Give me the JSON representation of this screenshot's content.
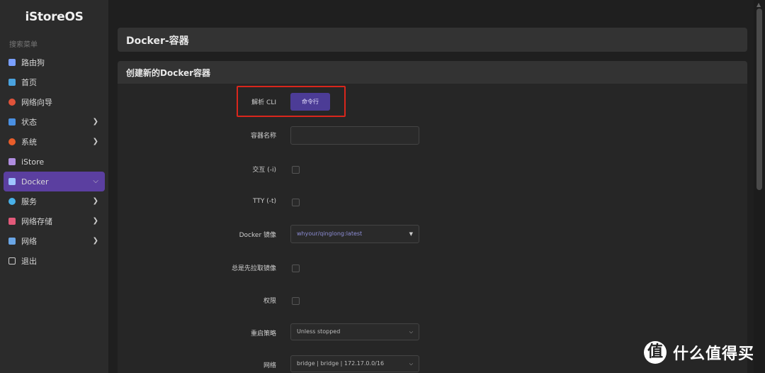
{
  "app": {
    "brand": "iStoreOS",
    "search_label": "搜索菜单"
  },
  "sidebar": {
    "items": [
      {
        "label": "路由狗",
        "icon": "cube-icon",
        "color": "#7aa0ff",
        "chevron": false
      },
      {
        "label": "首页",
        "icon": "dashboard-icon",
        "color": "#4aa3df",
        "chevron": false
      },
      {
        "label": "网络向导",
        "icon": "wizard-icon",
        "color": "#e0533a",
        "chevron": false
      },
      {
        "label": "状态",
        "icon": "grid-icon",
        "color": "#4a90e2",
        "chevron": true
      },
      {
        "label": "系统",
        "icon": "gear-icon",
        "color": "#e85d2a",
        "chevron": true
      },
      {
        "label": "iStore",
        "icon": "store-icon",
        "color": "#b08ee0",
        "chevron": false
      },
      {
        "label": "Docker",
        "icon": "docker-icon",
        "color": "#9ec5ff",
        "chevron": true,
        "active": true
      },
      {
        "label": "服务",
        "icon": "services-icon",
        "color": "#49b0e8",
        "chevron": true
      },
      {
        "label": "网络存储",
        "icon": "storage-icon",
        "color": "#e35a7a",
        "chevron": true
      },
      {
        "label": "网络",
        "icon": "network-icon",
        "color": "#6aa6e6",
        "chevron": true
      },
      {
        "label": "退出",
        "icon": "logout-icon",
        "color": "#cccccc",
        "chevron": false
      }
    ]
  },
  "main": {
    "title": "Docker-容器",
    "section_title": "创建新的Docker容器",
    "form": {
      "cli": {
        "label": "解析 CLI",
        "button": "命令行"
      },
      "name": {
        "label": "容器名称",
        "value": ""
      },
      "interactive": {
        "label": "交互 (-i)",
        "checked": false
      },
      "tty": {
        "label": "TTY (-t)",
        "checked": false
      },
      "image": {
        "label": "Docker 镜像",
        "value": "whyour/qinglong:latest"
      },
      "always_pull": {
        "label": "总是先拉取镜像",
        "checked": false
      },
      "privileged": {
        "label": "权限",
        "checked": false
      },
      "restart": {
        "label": "重启策略",
        "value": "Unless stopped"
      },
      "network": {
        "label": "网络",
        "value": "bridge | bridge | 172.17.0.0/16"
      }
    }
  },
  "watermark": {
    "text": "什么值得买",
    "logo": "值"
  }
}
